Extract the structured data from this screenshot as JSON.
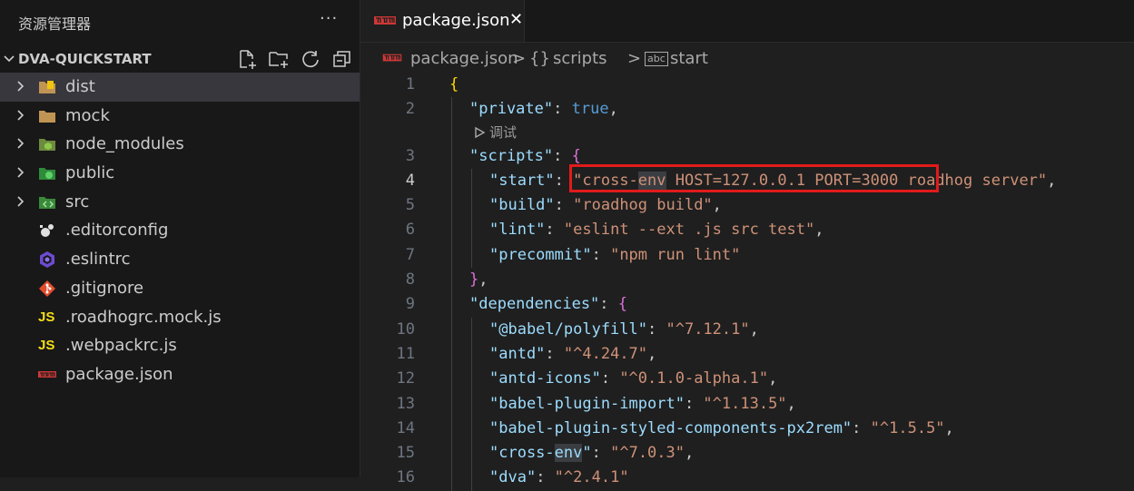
{
  "sidebar": {
    "title": "资源管理器",
    "more": "···",
    "project": "DVA-QUICKSTART",
    "items": [
      {
        "label": "dist",
        "type": "folder"
      },
      {
        "label": "mock",
        "type": "folder"
      },
      {
        "label": "node_modules",
        "type": "folder"
      },
      {
        "label": "public",
        "type": "folder"
      },
      {
        "label": "src",
        "type": "folder"
      },
      {
        "label": ".editorconfig",
        "type": "file"
      },
      {
        "label": ".eslintrc",
        "type": "file"
      },
      {
        "label": ".gitignore",
        "type": "file"
      },
      {
        "label": ".roadhogrc.mock.js",
        "type": "file",
        "icon_text": "JS"
      },
      {
        "label": ".webpackrc.js",
        "type": "file",
        "icon_text": "JS"
      },
      {
        "label": "package.json",
        "type": "file"
      }
    ]
  },
  "editor": {
    "tab": {
      "label": "package.json",
      "close": "✕"
    },
    "breadcrumb": {
      "file": "package.json",
      "sep": ">",
      "braces": "{}",
      "scripts": "scripts",
      "abc": "abc",
      "start": "start"
    },
    "codelens": "调试",
    "lines": [
      {
        "n": "1",
        "indent": 0,
        "tokens": [
          {
            "t": "{",
            "c": "br1"
          }
        ]
      },
      {
        "n": "2",
        "indent": 1,
        "tokens": [
          {
            "t": "\"private\"",
            "c": "k"
          },
          {
            "t": ": ",
            "c": "p"
          },
          {
            "t": "true",
            "c": "b"
          },
          {
            "t": ",",
            "c": "p"
          }
        ]
      },
      {
        "n": "3",
        "indent": 1,
        "tokens": [
          {
            "t": "\"scripts\"",
            "c": "k"
          },
          {
            "t": ": ",
            "c": "p"
          },
          {
            "t": "{",
            "c": "br2"
          }
        ]
      },
      {
        "n": "4",
        "indent": 2,
        "active": true,
        "tokens": [
          {
            "t": "\"start\"",
            "c": "k"
          },
          {
            "t": ": ",
            "c": "p"
          },
          {
            "t": "\"cross-",
            "c": "s"
          },
          {
            "t": "env",
            "c": "s hl"
          },
          {
            "t": " HOST=127.0.0.1 PORT=3000 roadhog server\"",
            "c": "s"
          },
          {
            "t": ",",
            "c": "p"
          }
        ]
      },
      {
        "n": "5",
        "indent": 2,
        "tokens": [
          {
            "t": "\"build\"",
            "c": "k"
          },
          {
            "t": ": ",
            "c": "p"
          },
          {
            "t": "\"roadhog build\"",
            "c": "s"
          },
          {
            "t": ",",
            "c": "p"
          }
        ]
      },
      {
        "n": "6",
        "indent": 2,
        "tokens": [
          {
            "t": "\"lint\"",
            "c": "k"
          },
          {
            "t": ": ",
            "c": "p"
          },
          {
            "t": "\"eslint --ext .js src test\"",
            "c": "s"
          },
          {
            "t": ",",
            "c": "p"
          }
        ]
      },
      {
        "n": "7",
        "indent": 2,
        "tokens": [
          {
            "t": "\"precommit\"",
            "c": "k"
          },
          {
            "t": ": ",
            "c": "p"
          },
          {
            "t": "\"npm run lint\"",
            "c": "s"
          }
        ]
      },
      {
        "n": "8",
        "indent": 1,
        "tokens": [
          {
            "t": "}",
            "c": "br2"
          },
          {
            "t": ",",
            "c": "p"
          }
        ]
      },
      {
        "n": "9",
        "indent": 1,
        "tokens": [
          {
            "t": "\"dependencies\"",
            "c": "k"
          },
          {
            "t": ": ",
            "c": "p"
          },
          {
            "t": "{",
            "c": "br2"
          }
        ]
      },
      {
        "n": "10",
        "indent": 2,
        "tokens": [
          {
            "t": "\"@babel/polyfill\"",
            "c": "k"
          },
          {
            "t": ": ",
            "c": "p"
          },
          {
            "t": "\"^7.12.1\"",
            "c": "s"
          },
          {
            "t": ",",
            "c": "p"
          }
        ]
      },
      {
        "n": "11",
        "indent": 2,
        "tokens": [
          {
            "t": "\"antd\"",
            "c": "k"
          },
          {
            "t": ": ",
            "c": "p"
          },
          {
            "t": "\"^4.24.7\"",
            "c": "s"
          },
          {
            "t": ",",
            "c": "p"
          }
        ]
      },
      {
        "n": "12",
        "indent": 2,
        "tokens": [
          {
            "t": "\"antd-icons\"",
            "c": "k"
          },
          {
            "t": ": ",
            "c": "p"
          },
          {
            "t": "\"^0.1.0-alpha.1\"",
            "c": "s"
          },
          {
            "t": ",",
            "c": "p"
          }
        ]
      },
      {
        "n": "13",
        "indent": 2,
        "tokens": [
          {
            "t": "\"babel-plugin-import\"",
            "c": "k"
          },
          {
            "t": ": ",
            "c": "p"
          },
          {
            "t": "\"^1.13.5\"",
            "c": "s"
          },
          {
            "t": ",",
            "c": "p"
          }
        ]
      },
      {
        "n": "14",
        "indent": 2,
        "tokens": [
          {
            "t": "\"babel-plugin-styled-components-px2rem\"",
            "c": "k"
          },
          {
            "t": ": ",
            "c": "p"
          },
          {
            "t": "\"^1.5.5\"",
            "c": "s"
          },
          {
            "t": ",",
            "c": "p"
          }
        ]
      },
      {
        "n": "15",
        "indent": 2,
        "tokens": [
          {
            "t": "\"cross-",
            "c": "k"
          },
          {
            "t": "env",
            "c": "k hl"
          },
          {
            "t": "\"",
            "c": "k"
          },
          {
            "t": ": ",
            "c": "p"
          },
          {
            "t": "\"^7.0.3\"",
            "c": "s"
          },
          {
            "t": ",",
            "c": "p"
          }
        ]
      },
      {
        "n": "16",
        "indent": 2,
        "tokens": [
          {
            "t": "\"dva\"",
            "c": "k"
          },
          {
            "t": ": ",
            "c": "p"
          },
          {
            "t": "\"^2.4.1\"",
            "c": "s"
          }
        ]
      }
    ]
  }
}
